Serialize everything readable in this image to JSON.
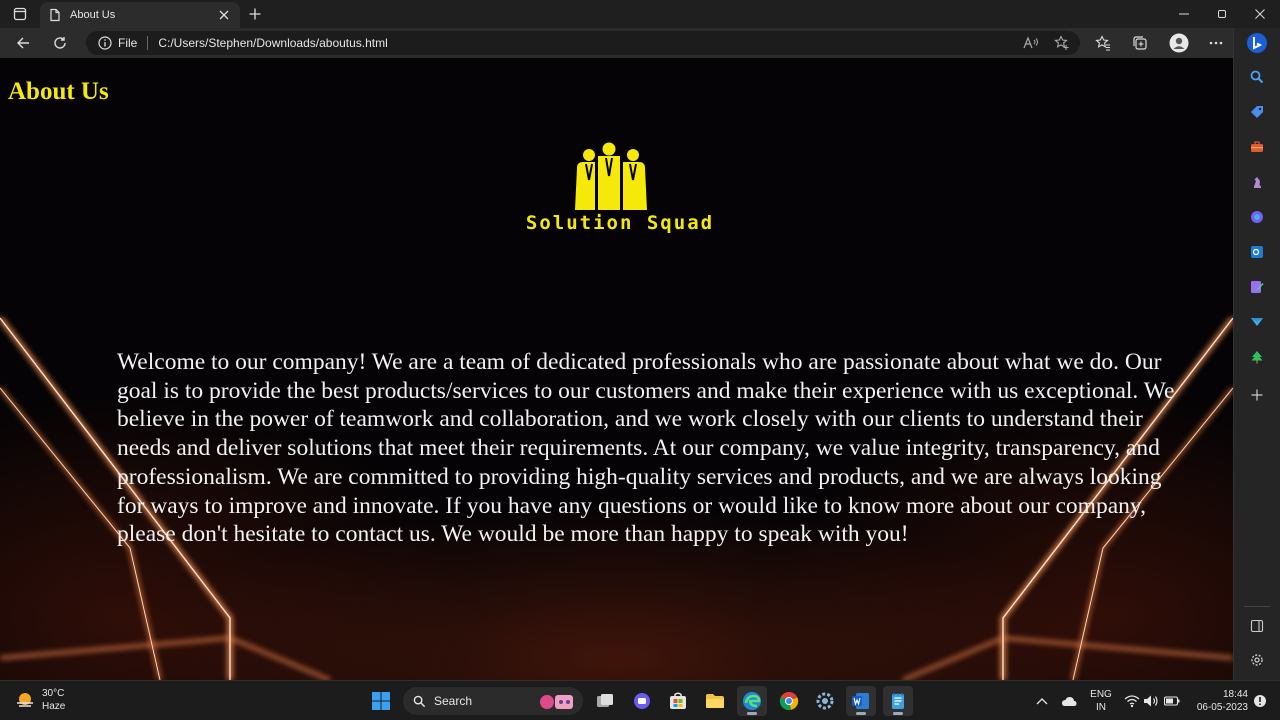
{
  "browser": {
    "tab": {
      "title": "About Us"
    },
    "address": {
      "scheme": "File",
      "url": "C:/Users/Stephen/Downloads/aboutus.html"
    },
    "accent": "#f5e90a"
  },
  "page": {
    "heading": "About Us",
    "logo": {
      "text": "Solution Squad",
      "icon": "team-people-icon"
    },
    "intro": "Welcome to our company! We are a team of dedicated professionals who are passionate about what we do. Our goal is to provide the best products/services to our customers and make their experience with us exceptional. We believe in the power of teamwork and collaboration, and we work closely with our clients to understand their needs and deliver solutions that meet their requirements. At our company, we value integrity, transparency, and professionalism. We are committed to providing high-quality services and products, and we are always looking for ways to improve and innovate. If you have any questions or would like to know more about our company, please don't hesitate to contact us. We would be more than happy to speak with you!"
  },
  "taskbar": {
    "weather": {
      "temp": "30°C",
      "condition": "Haze"
    },
    "search": {
      "label": "Search"
    },
    "language": {
      "line1": "ENG",
      "line2": "IN"
    },
    "clock": {
      "time": "18:44",
      "date": "06-05-2023"
    }
  }
}
